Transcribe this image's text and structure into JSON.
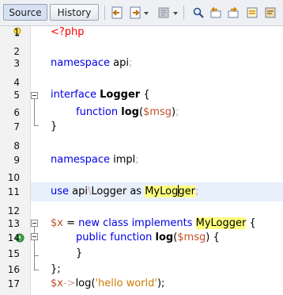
{
  "tabs": {
    "source": "Source",
    "history": "History"
  },
  "toolbar_icons": [
    "back-icon",
    "forward-icon",
    "bookmark-icon",
    "find-icon",
    "find-previous-icon",
    "find-next-icon",
    "toggle-highlight-icon",
    "comment-icon"
  ],
  "lines": [
    {
      "n": "1"
    },
    {
      "n": "2"
    },
    {
      "n": "3"
    },
    {
      "n": "4"
    },
    {
      "n": "5"
    },
    {
      "n": "6"
    },
    {
      "n": "7"
    },
    {
      "n": "8"
    },
    {
      "n": "9"
    },
    {
      "n": "10"
    },
    {
      "n": "11"
    },
    {
      "n": "12"
    },
    {
      "n": "13"
    },
    {
      "n": "14"
    },
    {
      "n": "15"
    },
    {
      "n": "16"
    },
    {
      "n": "17"
    }
  ],
  "code": {
    "l1_tag": "<?php",
    "l3_kw": "namespace",
    "l3_name": " api",
    "l3_semi": ";",
    "l5_kw": "interface",
    "l5_name": "Logger",
    "l5_brace": " {",
    "l6_kw": "function",
    "l6_name": "log",
    "l6_open": "(",
    "l6_var": "$msg",
    "l6_close": ")",
    "l6_semi": ";",
    "l7_brace": "}",
    "l9_kw": "namespace",
    "l9_name": " impl",
    "l9_semi": ";",
    "l11_kw": "use",
    "l11_ns": " api",
    "l11_bs": "\\",
    "l11_cls": "Logger",
    "l11_as": " as ",
    "l11_alias_a": "MyLog",
    "l11_alias_b": "ger",
    "l11_semi": ";",
    "l13_var": "$x",
    "l13_eq": " = ",
    "l13_new": "new",
    "l13_class": " class ",
    "l13_impl": "implements",
    "l13_sp": " ",
    "l13_alias": "MyLogger",
    "l13_brace": " {",
    "l14_pub": "public",
    "l14_fn": " function ",
    "l14_name": "log",
    "l14_open": "(",
    "l14_var": "$msg",
    "l14_close": ") {",
    "l15_brace": "}",
    "l16_close": "};",
    "l17_var": "$x",
    "l17_arrow": "->",
    "l17_call": "log(",
    "l17_str": "'hello world'",
    "l17_end": ");"
  }
}
